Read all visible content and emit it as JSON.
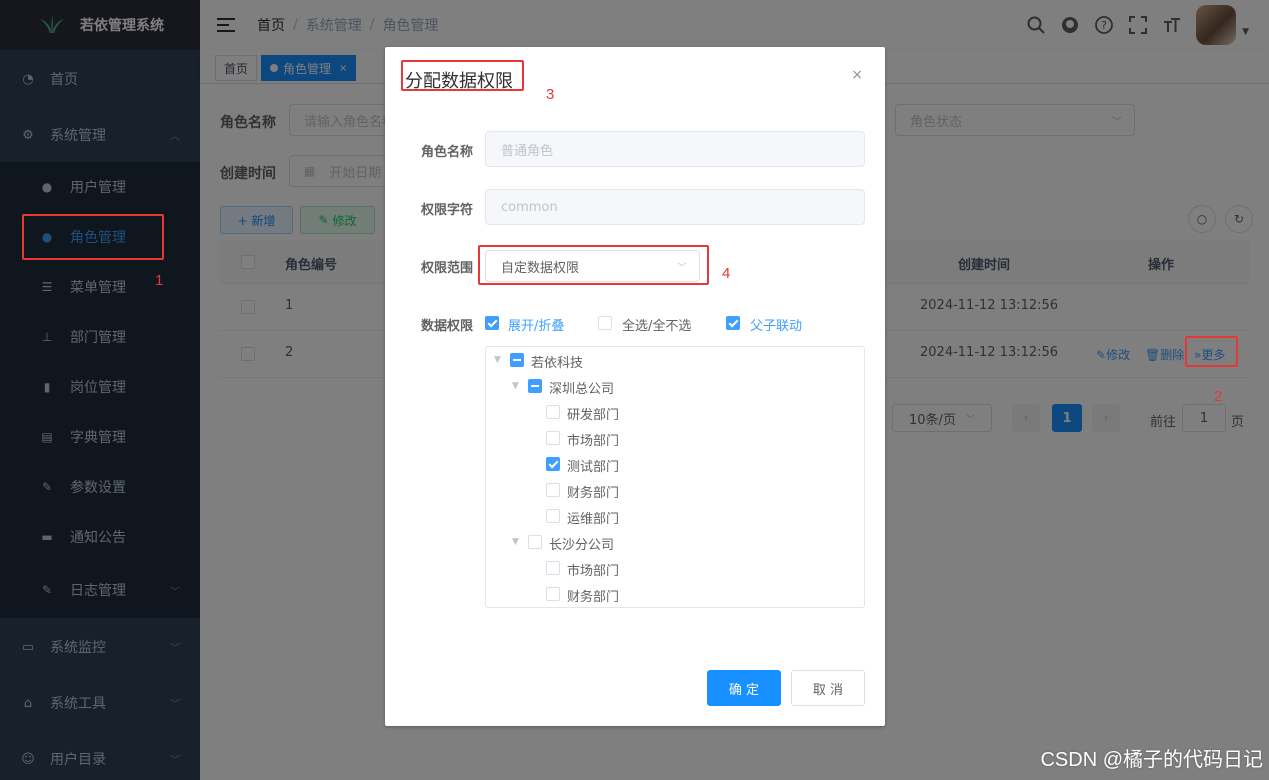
{
  "sidebar": {
    "title": "若依管理系统",
    "items": [
      {
        "label": "首页",
        "icon": "dashboard-icon"
      },
      {
        "label": "系统管理",
        "icon": "gear-icon",
        "expanded": true
      },
      {
        "label": "系统监控",
        "icon": "monitor-icon"
      },
      {
        "label": "系统工具",
        "icon": "tool-icon"
      },
      {
        "label": "用户目录",
        "icon": "chat-icon"
      }
    ],
    "sub_items": [
      {
        "label": "用户管理",
        "icon": "user-icon"
      },
      {
        "label": "角色管理",
        "icon": "peoples-icon",
        "active": true
      },
      {
        "label": "菜单管理",
        "icon": "tree-table-icon"
      },
      {
        "label": "部门管理",
        "icon": "tree-icon"
      },
      {
        "label": "岗位管理",
        "icon": "post-icon"
      },
      {
        "label": "字典管理",
        "icon": "dict-icon"
      },
      {
        "label": "参数设置",
        "icon": "edit-icon"
      },
      {
        "label": "通知公告",
        "icon": "message-icon"
      },
      {
        "label": "日志管理",
        "icon": "log-icon"
      }
    ]
  },
  "navbar": {
    "breadcrumb": [
      "首页",
      "系统管理",
      "角色管理"
    ]
  },
  "tags": {
    "home": "首页",
    "active": "角色管理",
    "close": "×"
  },
  "search_form": {
    "role_name_label": "角色名称",
    "role_name_placeholder": "请输入角色名称",
    "status_placeholder": "角色状态",
    "created_label": "创建时间",
    "start_date_placeholder": "开始日期"
  },
  "toolbar": {
    "add": "+ 新增",
    "edit": "修改"
  },
  "table": {
    "headers": {
      "id": "角色编号",
      "created": "创建时间",
      "actions": "操作"
    },
    "rows": [
      {
        "id": "1",
        "created": "2024-11-12 13:12:56"
      },
      {
        "id": "2",
        "created": "2024-11-12 13:12:56",
        "edit": "修改",
        "delete": "删除",
        "more": "更多"
      }
    ]
  },
  "pagination": {
    "page_size": "10条/页",
    "current_page": "1",
    "goto_label": "前往",
    "goto_value": "1",
    "page_suffix": "页"
  },
  "dialog": {
    "title": "分配数据权限",
    "close": "×",
    "role_name_label": "角色名称",
    "role_name_value": "普通角色",
    "perm_key_label": "权限字符",
    "perm_key_value": "common",
    "scope_label": "权限范围",
    "scope_value": "自定数据权限",
    "data_perm_label": "数据权限",
    "expand_label": "展开/折叠",
    "select_all_label": "全选/全不选",
    "linkage_label": "父子联动",
    "confirm": "确 定",
    "cancel": "取 消",
    "tree": [
      {
        "label": "若依科技",
        "level": 0,
        "state": "half",
        "caret": true
      },
      {
        "label": "深圳总公司",
        "level": 1,
        "state": "half",
        "caret": true
      },
      {
        "label": "研发部门",
        "level": 2,
        "state": "off"
      },
      {
        "label": "市场部门",
        "level": 2,
        "state": "off"
      },
      {
        "label": "测试部门",
        "level": 2,
        "state": "on"
      },
      {
        "label": "财务部门",
        "level": 2,
        "state": "off"
      },
      {
        "label": "运维部门",
        "level": 2,
        "state": "off"
      },
      {
        "label": "长沙分公司",
        "level": 1,
        "state": "off",
        "caret": true
      },
      {
        "label": "市场部门",
        "level": 2,
        "state": "off"
      },
      {
        "label": "财务部门",
        "level": 2,
        "state": "off"
      }
    ]
  },
  "annotations": [
    "1",
    "2",
    "3",
    "4"
  ],
  "watermark": "CSDN @橘子的代码日记",
  "colors": {
    "primary": "#409eff",
    "sidebar_bg": "#304156",
    "annotation_red": "#e53935"
  }
}
